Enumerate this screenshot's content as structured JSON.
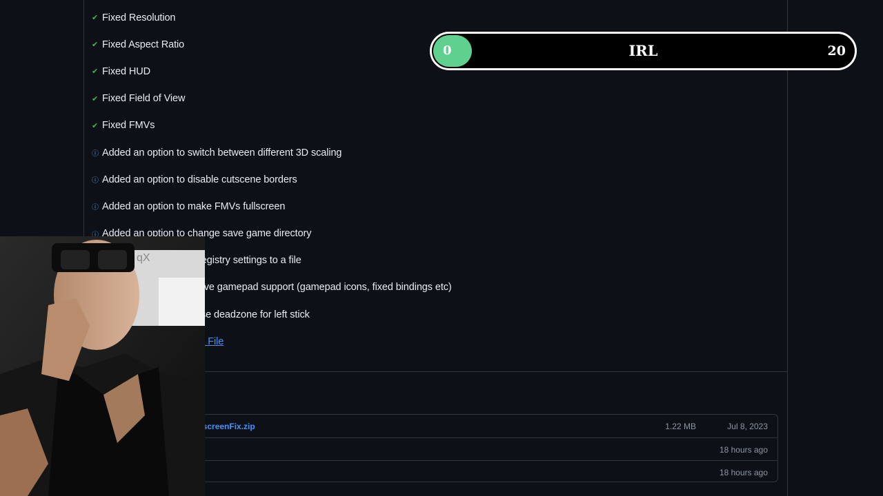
{
  "features": [
    {
      "icon": "check-icon",
      "text": "Fixed Resolution"
    },
    {
      "icon": "check-icon",
      "text": "Fixed Aspect Ratio"
    },
    {
      "icon": "check-icon",
      "text": "Fixed HUD"
    },
    {
      "icon": "check-icon",
      "text": "Fixed Field of View"
    },
    {
      "icon": "check-icon",
      "text": "Fixed FMVs"
    },
    {
      "icon": "info-icon",
      "text": "Added an option to switch between different 3D scaling"
    },
    {
      "icon": "info-icon",
      "text": "Added an option to disable cutscene borders"
    },
    {
      "icon": "info-icon",
      "text": "Added an option to make FMVs fullscreen"
    },
    {
      "icon": "info-icon",
      "text": "Added an option to change save game directory"
    },
    {
      "icon": "info-icon",
      "text": "write registry settings to a file"
    },
    {
      "icon": "info-icon",
      "text": "rove gamepad support (gamepad icons, fixed bindings etc)"
    },
    {
      "icon": "info-icon",
      "text": "ase deadzone for left stick"
    }
  ],
  "ini_link": "NI File",
  "assets": [
    {
      "name": "escreenFix.zip",
      "size": "1.22 MB",
      "date": "Jul 8, 2023"
    },
    {
      "name": "",
      "size": "",
      "date": "18 hours ago"
    },
    {
      "name": "",
      "size": "",
      "date": "18 hours ago"
    }
  ],
  "score_overlay": {
    "current": "0",
    "label": "IRL",
    "max": "20",
    "fill_color": "#5fd08e"
  },
  "webcam": {
    "overlay_text": "qX"
  },
  "colors": {
    "background": "#0d1117",
    "check": "#3fb950",
    "info": "#58a6ff",
    "link": "#4493f8",
    "border": "#30363d"
  }
}
